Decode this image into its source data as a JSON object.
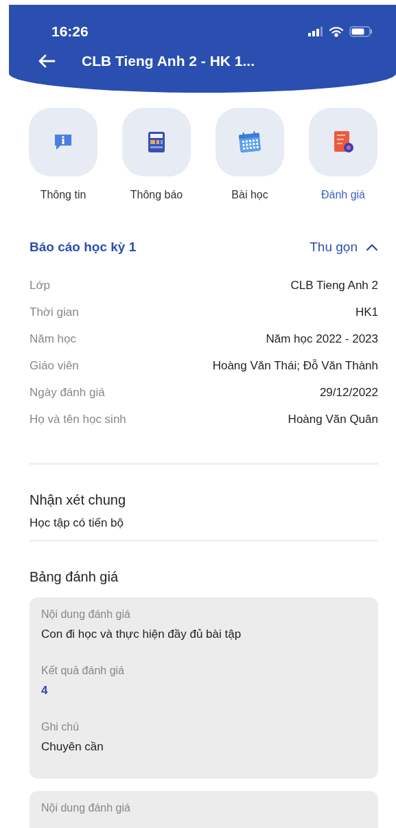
{
  "status_bar": {
    "time": "16:26"
  },
  "header": {
    "title": "CLB Tieng Anh 2 - HK 1..."
  },
  "tabs": [
    {
      "label": "Thông tin",
      "selected": false
    },
    {
      "label": "Thông báo",
      "selected": false
    },
    {
      "label": "Bài học",
      "selected": false
    },
    {
      "label": "Đánh giá",
      "selected": true
    }
  ],
  "report": {
    "title": "Báo cáo học kỳ 1",
    "toggle": "Thu gọn",
    "expanded": true,
    "fields": [
      {
        "label": "Lớp",
        "value": "CLB Tieng Anh 2"
      },
      {
        "label": "Thời gian",
        "value": "HK1"
      },
      {
        "label": "Năm học",
        "value": "Năm học 2022 - 2023"
      },
      {
        "label": "Giáo viên",
        "value": "Hoàng Văn Thái; Đỗ Văn Thành"
      },
      {
        "label": "Ngày đánh giá",
        "value": "29/12/2022"
      },
      {
        "label": "Họ và tên học sinh",
        "value": "Hoàng Văn Quân"
      }
    ]
  },
  "general_comment": {
    "title": "Nhận xét chung",
    "text": "Học tập có tiến bộ"
  },
  "evaluation_table": {
    "title": "Bảng đánh giá",
    "cards": [
      {
        "items": [
          {
            "label": "Nội dung đánh giá",
            "value": "Con đi học và thực hiện đầy đủ bài tập",
            "kind": "text"
          },
          {
            "label": "Kết quả đánh giá",
            "value": "4",
            "kind": "score"
          },
          {
            "label": "Ghi chú",
            "value": "Chuyên cần",
            "kind": "text"
          }
        ]
      },
      {
        "items": [
          {
            "label": "Nội dung đánh giá"
          }
        ]
      }
    ]
  }
}
